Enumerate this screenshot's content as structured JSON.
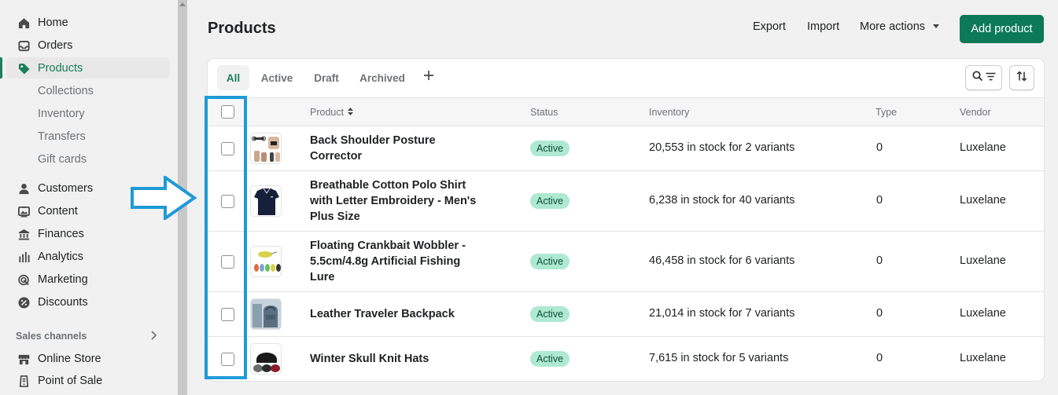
{
  "sidebar": {
    "items": [
      {
        "label": "Home",
        "icon": "home-icon"
      },
      {
        "label": "Orders",
        "icon": "inbox-icon"
      },
      {
        "label": "Products",
        "icon": "tag-icon"
      },
      {
        "label": "Collections"
      },
      {
        "label": "Inventory"
      },
      {
        "label": "Transfers"
      },
      {
        "label": "Gift cards"
      },
      {
        "label": "Customers",
        "icon": "person-icon"
      },
      {
        "label": "Content",
        "icon": "image-icon"
      },
      {
        "label": "Finances",
        "icon": "bank-icon"
      },
      {
        "label": "Analytics",
        "icon": "bar-chart-icon"
      },
      {
        "label": "Marketing",
        "icon": "target-icon"
      },
      {
        "label": "Discounts",
        "icon": "discount-icon"
      }
    ],
    "section_title": "Sales channels",
    "channels": [
      {
        "label": "Online Store",
        "icon": "store-icon"
      },
      {
        "label": "Point of Sale",
        "icon": "pos-icon"
      }
    ]
  },
  "header": {
    "title": "Products",
    "export_label": "Export",
    "import_label": "Import",
    "more_actions_label": "More actions",
    "add_product_label": "Add product"
  },
  "tabs": [
    {
      "label": "All"
    },
    {
      "label": "Active"
    },
    {
      "label": "Draft"
    },
    {
      "label": "Archived"
    }
  ],
  "table": {
    "columns": [
      "Product",
      "Status",
      "Inventory",
      "Type",
      "Vendor"
    ],
    "rows": [
      {
        "name": "Back Shoulder Posture Corrector",
        "status": "Active",
        "inventory": "20,553 in stock for 2 variants",
        "type": "0",
        "vendor": "Luxelane"
      },
      {
        "name": "Breathable Cotton Polo Shirt with Letter Embroidery - Men's Plus Size",
        "status": "Active",
        "inventory": "6,238 in stock for 40 variants",
        "type": "0",
        "vendor": "Luxelane"
      },
      {
        "name": "Floating Crankbait Wobbler - 5.5cm/4.8g Artificial Fishing Lure",
        "status": "Active",
        "inventory": "46,458 in stock for 6 variants",
        "type": "0",
        "vendor": "Luxelane"
      },
      {
        "name": "Leather Traveler Backpack",
        "status": "Active",
        "inventory": "21,014 in stock for 7 variants",
        "type": "0",
        "vendor": "Luxelane"
      },
      {
        "name": "Winter Skull Knit Hats",
        "status": "Active",
        "inventory": "7,615 in stock for 5 variants",
        "type": "0",
        "vendor": "Luxelane"
      }
    ]
  },
  "colors": {
    "accent": "#1a7f5a",
    "primary_button": "#0d7a57",
    "badge_bg": "#aee9d1",
    "annotation": "#1f9ad6"
  }
}
